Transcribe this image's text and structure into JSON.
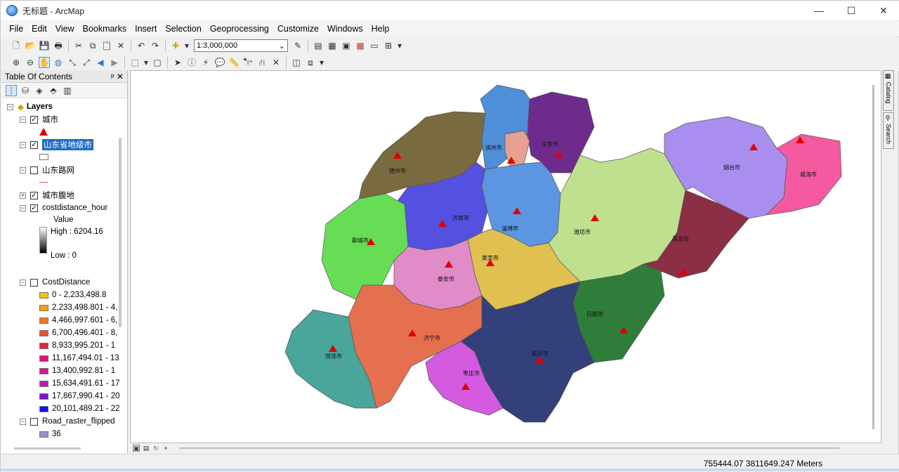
{
  "window": {
    "title": "无标题 - ArcMap",
    "min": "—",
    "max": "☐",
    "close": "✕"
  },
  "menu": [
    "File",
    "Edit",
    "View",
    "Bookmarks",
    "Insert",
    "Selection",
    "Geoprocessing",
    "Customize",
    "Windows",
    "Help"
  ],
  "toolbar": {
    "scale_value": "1:3,000,000"
  },
  "toc": {
    "title": "Table Of Contents",
    "pin": "ᵖ",
    "close": "✕",
    "group": "Layers",
    "layers": [
      {
        "name": "城市",
        "checked": true
      },
      {
        "name": "山东省地级市",
        "checked": true
      },
      {
        "name": "山东路网",
        "checked": false
      },
      {
        "name": "城市腹地",
        "checked": true
      },
      {
        "name": "costdistance_hour",
        "checked": true
      },
      {
        "name": "CostDistance",
        "checked": false
      },
      {
        "name": "Road_raster_flipped",
        "checked": false
      }
    ],
    "value_label": "Value",
    "high_label": "High : 6204.16",
    "low_label": "Low : 0",
    "cost_classes": [
      {
        "label": "0 - 2,233,498.8",
        "color": "#f5c400"
      },
      {
        "label": "2,233,498.801 - 4,",
        "color": "#f4a000"
      },
      {
        "label": "4,466,997.601 - 6,",
        "color": "#f07820"
      },
      {
        "label": "6,700,496.401 - 8,",
        "color": "#ef5030"
      },
      {
        "label": "8,933,995.201 - 1",
        "color": "#ea2040"
      },
      {
        "label": "11,167,494.01 - 13",
        "color": "#e41070"
      },
      {
        "label": "13,400,992.81 - 1",
        "color": "#d9158f"
      },
      {
        "label": "15,634,491.61 - 17",
        "color": "#b620b0"
      },
      {
        "label": "17,867,990.41 - 20",
        "color": "#8010d0"
      },
      {
        "label": "20,101,489.21 - 22",
        "color": "#1010ff"
      }
    ],
    "road_value": "36",
    "road_color": "#9b8fcf"
  },
  "map": {
    "regions": [
      {
        "name": "德州市",
        "color": "#7a6a3f"
      },
      {
        "name": "滨州市",
        "color": "#4f8ed8"
      },
      {
        "name": "东营市",
        "color": "#6e2b8c"
      },
      {
        "name": "烟台市",
        "color": "#a98ef0"
      },
      {
        "name": "威海市",
        "color": "#f55aa0"
      },
      {
        "name": "济南市",
        "color": "#5450e0"
      },
      {
        "name": "淄博市",
        "color": "#5c96e2"
      },
      {
        "name": "潍坊市",
        "color": "#bfe08f"
      },
      {
        "name": "青岛市",
        "color": "#8c2e45"
      },
      {
        "name": "聊城市",
        "color": "#66dd55"
      },
      {
        "name": "莱芜市",
        "color": "#e0c050"
      },
      {
        "name": "泰安市",
        "color": "#e08cc8"
      },
      {
        "name": "日照市",
        "color": "#2e7d3a"
      },
      {
        "name": "济宁市",
        "color": "#e57050"
      },
      {
        "name": "临沂市",
        "color": "#34407a"
      },
      {
        "name": "菏泽市",
        "color": "#4aa59a"
      },
      {
        "name": "枣庄市",
        "color": "#d45ae0"
      }
    ]
  },
  "status": {
    "coords": "755444.07  3811649.247 Meters"
  }
}
